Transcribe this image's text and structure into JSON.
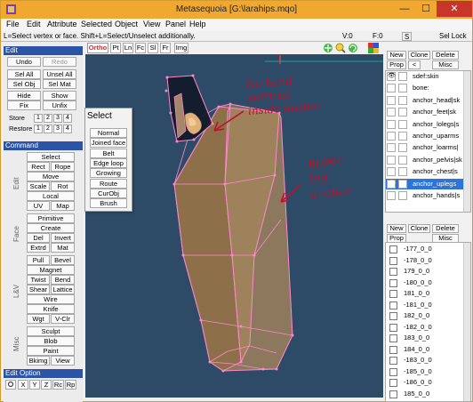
{
  "window": {
    "title": "Metasequoia [G:\\larahips.mqo]",
    "min": "—",
    "max": "☐",
    "close": "✕"
  },
  "menu": [
    "File",
    "Edit",
    "Attribute",
    "Selected",
    "Object",
    "View",
    "Panel",
    "Help"
  ],
  "status": {
    "hint": "L=Select vertex or face.  Shift+L=Select/Unselect additionally.",
    "vertices": "V:0",
    "faces": "F:0",
    "s": "S",
    "lock": "Sel Lock"
  },
  "left": {
    "edit_header": "Edit",
    "undo": "Undo",
    "redo": "Redo",
    "sel_all": "Sel All",
    "unsel_all": "Unsel All",
    "sel_obj": "Sel Obj",
    "sel_mat": "Sel Mat",
    "hide": "Hide",
    "show": "Show",
    "fix": "Fix",
    "unfix": "Unfix",
    "store": "Store",
    "restore": "Restore",
    "nums": [
      "1",
      "2",
      "3",
      "4"
    ],
    "command_header": "Command",
    "select": "Select",
    "rect": "Rect",
    "rope": "Rope",
    "move": "Move",
    "scale": "Scale",
    "rot": "Rot",
    "local": "Local",
    "uv": "UV",
    "map": "Map",
    "edit_label": "Edit",
    "primitive": "Primitive",
    "create": "Create",
    "del": "Del",
    "invert": "Invert",
    "extrd": "Extrd",
    "mat": "Mat",
    "face_label": "Face",
    "pull": "Pull",
    "bevel": "Bevel",
    "magnet": "Magnet",
    "twist": "Twist",
    "bend": "Bend",
    "shear": "Shear",
    "lattice": "Lattice",
    "wire": "Wire",
    "knife": "Knife",
    "wgt": "Wgt",
    "vclr": "V-Clr",
    "lv_label": "L&V",
    "sculpt": "Sculpt",
    "blob": "Blob",
    "paint": "Paint",
    "bkimg": "Bkimg",
    "view": "View",
    "misc_label": "Misc",
    "edit_option_header": "Edit Option",
    "axes": [
      "X",
      "Y",
      "Z",
      "Rc",
      "Rp"
    ]
  },
  "viewport": {
    "tabs": [
      "Ortho",
      "Pt",
      "Ln",
      "Fc",
      "Sl",
      "Fr",
      "Img"
    ]
  },
  "select_popup": {
    "title": "Select",
    "buttons": [
      "Normal",
      "Joined face",
      "Belt",
      "Edge loop",
      "Growing",
      "Route",
      "CurObj",
      "Brush"
    ]
  },
  "annotations": {
    "note1": [
      "No hand",
      "vertices",
      "inside anchor"
    ],
    "note2": [
      "upper",
      "leg",
      "anchor"
    ]
  },
  "objects": {
    "buttons": [
      "New",
      "Clone",
      "Delete",
      "Prop",
      "<",
      "Misc"
    ],
    "items": [
      "sdef:skin",
      "bone:",
      "anchor_head|sk",
      "anchor_feet|sk",
      "anchor_lolegs|s",
      "anchor_uparms",
      "anchor_loarms|",
      "anchor_pelvis|sk",
      "anchor_chest|s",
      "anchor_uplegs",
      "anchor_hands|s"
    ],
    "selected_index": 9
  },
  "materials": {
    "buttons": [
      "New",
      "Clone",
      "Delete",
      "Prop",
      "Misc"
    ],
    "items": [
      "-177_0_0",
      "-178_0_0",
      "179_0_0",
      "-180_0_0",
      "181_0_0",
      "-181_0_0",
      "182_0_0",
      "-182_0_0",
      "183_0_0",
      "184_0_0",
      "-183_0_0",
      "-185_0_0",
      "-186_0_0",
      "185_0_0"
    ]
  },
  "colors": {
    "title_bar": "#f0a830",
    "viewport_bg": "#2d4b67",
    "header_blue": "#2b53a6",
    "mesh": "#ff88cc",
    "ink": "#c0102a",
    "selected": "#2e73d8"
  }
}
